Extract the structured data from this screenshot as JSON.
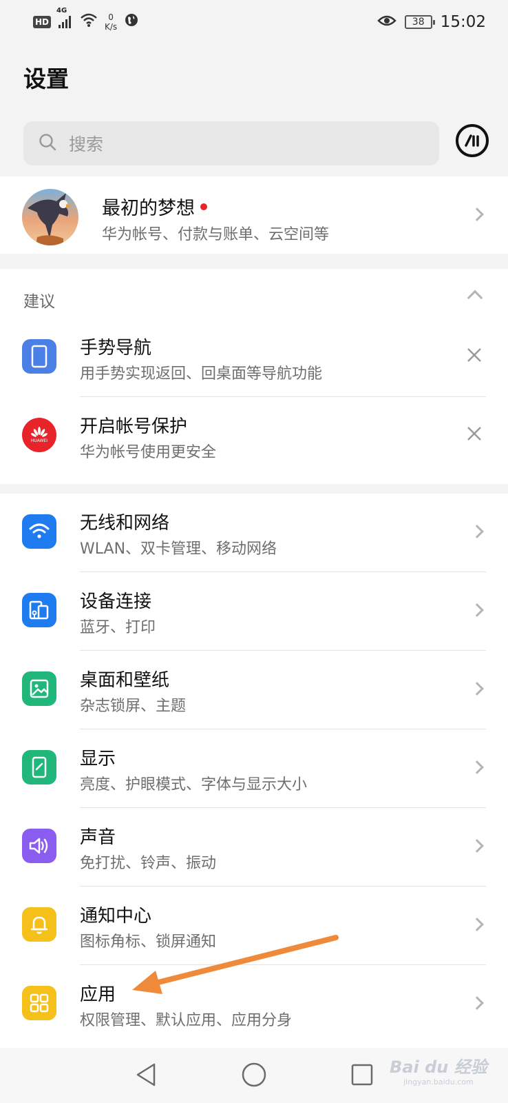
{
  "status_bar": {
    "network": "4G",
    "speed_value": "0",
    "speed_unit": "K/s",
    "battery": "38",
    "time": "15:02"
  },
  "page_title": "设置",
  "search": {
    "placeholder": "搜索"
  },
  "account": {
    "name": "最初的梦想",
    "subtitle": "华为帐号、付款与账单、云空间等"
  },
  "suggestions": {
    "label": "建议",
    "items": [
      {
        "title": "手势导航",
        "subtitle": "用手势实现返回、回桌面等导航功能",
        "icon": "phone-icon",
        "color": "#4a7fe6"
      },
      {
        "title": "开启帐号保护",
        "subtitle": "华为帐号使用更安全",
        "icon": "huawei-logo",
        "color": "#e8232a",
        "logo_text": "HUAWEI"
      }
    ]
  },
  "settings": [
    {
      "title": "无线和网络",
      "subtitle": "WLAN、双卡管理、移动网络",
      "icon": "wifi-icon",
      "color": "#1f7cf0"
    },
    {
      "title": "设备连接",
      "subtitle": "蓝牙、打印",
      "icon": "device-connection-icon",
      "color": "#1f7cf0"
    },
    {
      "title": "桌面和壁纸",
      "subtitle": "杂志锁屏、主题",
      "icon": "wallpaper-icon",
      "color": "#21b67a"
    },
    {
      "title": "显示",
      "subtitle": "亮度、护眼模式、字体与显示大小",
      "icon": "display-icon",
      "color": "#21b67a"
    },
    {
      "title": "声音",
      "subtitle": "免打扰、铃声、振动",
      "icon": "speaker-icon",
      "color": "#8a5cf0"
    },
    {
      "title": "通知中心",
      "subtitle": "图标角标、锁屏通知",
      "icon": "bell-icon",
      "color": "#f5c019"
    },
    {
      "title": "应用",
      "subtitle": "权限管理、默认应用、应用分身",
      "icon": "apps-grid-icon",
      "color": "#f5c019"
    }
  ],
  "annotation": {
    "color": "#ef8a3a"
  },
  "watermark": {
    "text": "Bai du 经验",
    "site": "jingyan.baidu.com"
  }
}
